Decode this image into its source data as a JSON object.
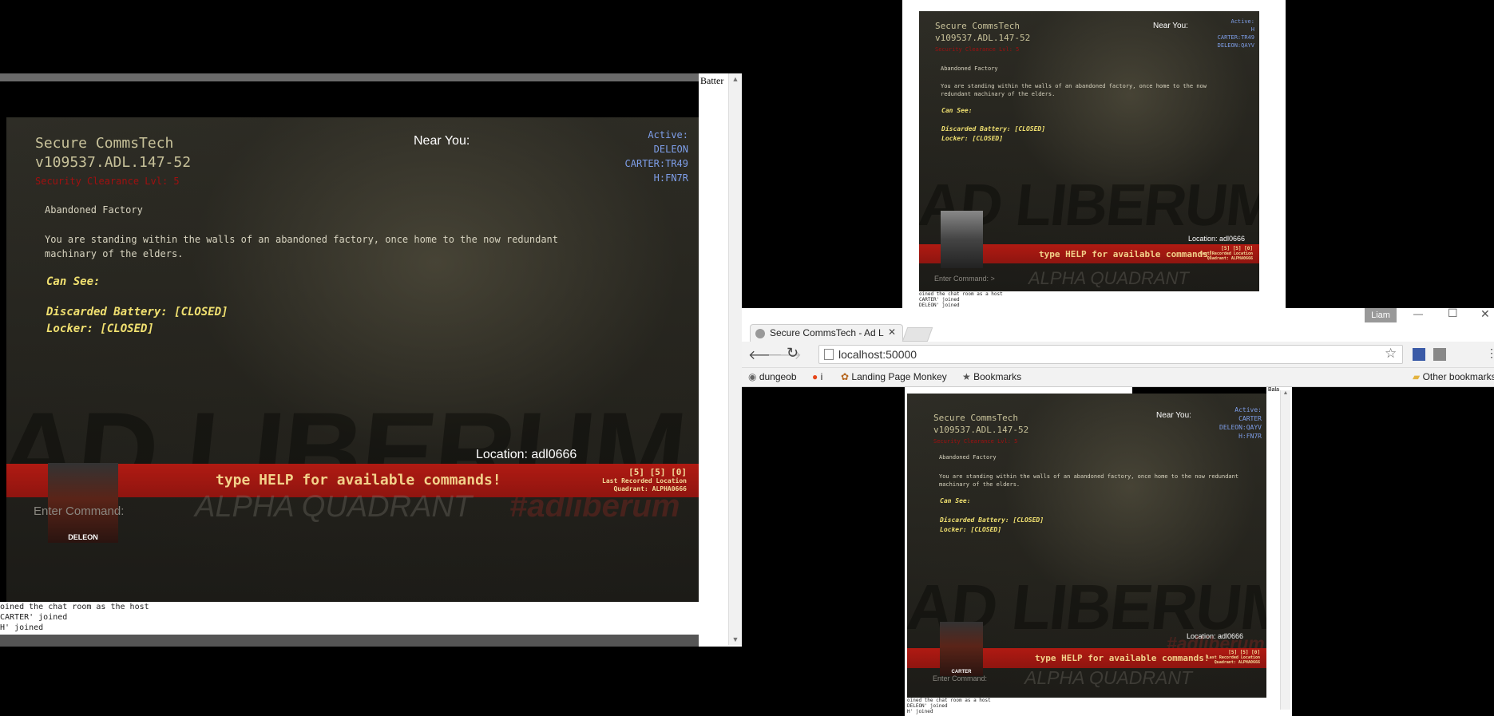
{
  "game": {
    "title_line1": "Secure CommsTech",
    "title_line2": "v109537.ADL.147-52",
    "clearance": "Security Clearance Lvl: 5",
    "room_name": "Abandoned Factory",
    "room_desc": "You are standing within the walls of an abandoned factory, once home to the now redundant machinary of the elders.",
    "can_see_label": "Can See:",
    "items": [
      "Discarded Battery: [CLOSED]",
      "Locker: [CLOSED]"
    ],
    "near_you_label": "Near You:",
    "active_label": "Active:",
    "help_text": "type HELP for available commands!",
    "stats_values": "[5] [5] [0]",
    "last_location_label": "Last Recorded Location",
    "quadrant_text": "Quadrant: ALPHA0666",
    "enter_command_label": "Enter Command:",
    "quadrant_watermark": "ALPHA QUADRANT",
    "ad_liberum": "AD LIBERUM",
    "hashtag": "#adliberum"
  },
  "left_window": {
    "location": "Location: adl0666",
    "active_players": [
      "DELEON",
      "CARTER:TR49",
      "H:FN7R"
    ],
    "portrait_name": "DELEON",
    "chat_lines": [
      "oined the chat room as the host",
      "CARTER' joined",
      "H' joined"
    ],
    "side_panel_text": "Batter"
  },
  "top_right_window": {
    "location": "Location: adl0666",
    "active_players": [
      "H",
      "CARTER:TR49",
      "DELEON:QAYV"
    ],
    "prompt": "Enter Command:  >",
    "chat_lines": [
      "oined the chat room as a host",
      "CARTER' joined",
      "DELEON' joined"
    ]
  },
  "browser": {
    "tab_title": "Secure CommsTech - Ad L",
    "profile_name": "Liam",
    "url": "localhost:50000",
    "bookmarks": [
      "dungeob",
      "i",
      "Landing Page Monkey",
      "Bookmarks"
    ],
    "other_bookmarks": "Other bookmarks",
    "window_min": "—",
    "window_max": "☐",
    "window_close": "✕"
  },
  "bottom_right_window": {
    "location": "Location: adl0666",
    "active_players": [
      "CARTER",
      "DELEON:QAYV",
      "H:FN7R"
    ],
    "portrait_name": "CARTER",
    "chat_lines": [
      "oined the chat room as a host",
      "DELEON' joined",
      "H' joined"
    ],
    "side_panel_text": "Bala"
  }
}
